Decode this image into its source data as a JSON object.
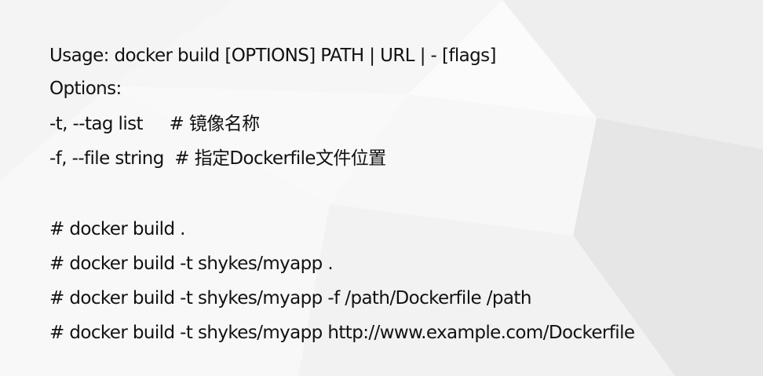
{
  "usage_block": {
    "usage_line": "Usage: docker build [OPTIONS] PATH | URL | - [flags]",
    "options_heading": "Options:",
    "option_tag": "-t, --tag list     # 镜像名称",
    "option_file": "-f, --file string  # 指定Dockerfile文件位置"
  },
  "examples": [
    "# docker build .",
    "# docker build -t shykes/myapp .",
    "# docker build -t shykes/myapp -f /path/Dockerfile /path",
    "# docker build -t shykes/myapp http://www.example.com/Dockerfile"
  ]
}
